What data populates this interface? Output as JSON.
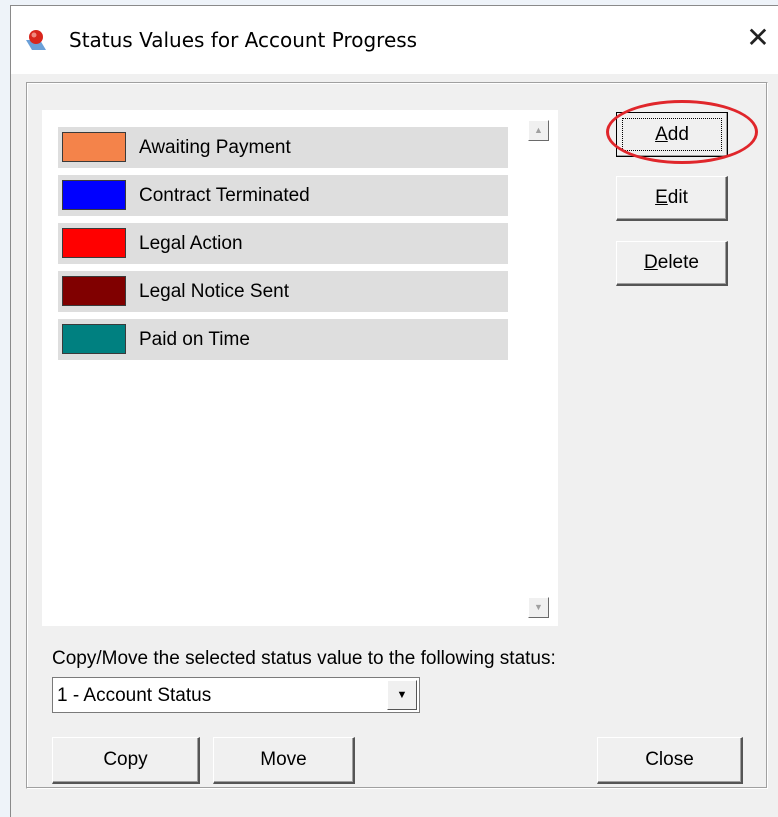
{
  "window": {
    "title": "Status Values for Account Progress",
    "close_glyph": "✕"
  },
  "status_list": {
    "items": [
      {
        "label": "Awaiting Payment",
        "color": "#f4834a"
      },
      {
        "label": "Contract Terminated",
        "color": "#0000ff"
      },
      {
        "label": "Legal Action",
        "color": "#ff0000"
      },
      {
        "label": "Legal Notice Sent",
        "color": "#800000"
      },
      {
        "label": "Paid on Time",
        "color": "#008080"
      }
    ]
  },
  "scrollbar": {
    "up_glyph": "▲",
    "down_glyph": "▼"
  },
  "buttons": {
    "add": {
      "mnemonic": "A",
      "rest": "dd"
    },
    "edit": {
      "mnemonic": "E",
      "rest": "dit"
    },
    "delete": {
      "mnemonic": "D",
      "rest": "elete"
    },
    "copy": "Copy",
    "move": "Move",
    "close": "Close"
  },
  "copy_move": {
    "label": "Copy/Move the selected status value to the following status:",
    "selected": "1 - Account Status",
    "arrow_glyph": "▼"
  },
  "colors": {
    "highlight_ring": "#e0262b",
    "dialog_bg": "#f0f0f0"
  },
  "icons": {
    "app": "app-logo-icon",
    "close": "close-icon",
    "scroll_up": "scroll-up-arrow-icon",
    "scroll_down": "scroll-down-arrow-icon",
    "dropdown": "dropdown-arrow-icon"
  }
}
